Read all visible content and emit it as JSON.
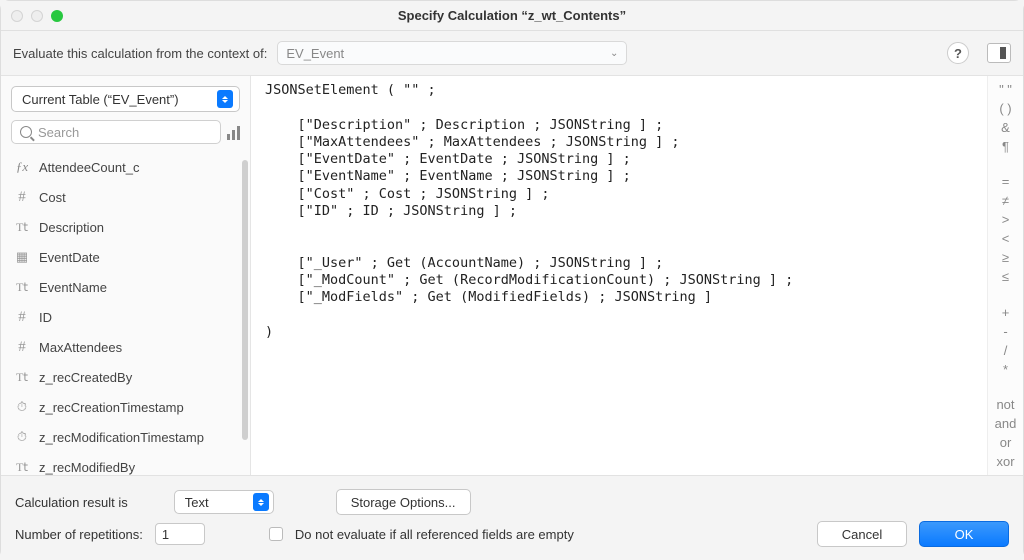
{
  "window": {
    "title": "Specify Calculation “z_wt_Contents”"
  },
  "context": {
    "label": "Evaluate this calculation from the context of:",
    "value": "EV_Event",
    "help": "?"
  },
  "sidebar": {
    "table_select": "Current Table (“EV_Event”)",
    "search_placeholder": "Search",
    "fields": [
      {
        "icon": "fx",
        "label": "AttendeeCount_c"
      },
      {
        "icon": "hash",
        "label": "Cost"
      },
      {
        "icon": "tt",
        "label": "Description"
      },
      {
        "icon": "cal",
        "label": "EventDate"
      },
      {
        "icon": "tt",
        "label": "EventName"
      },
      {
        "icon": "hash",
        "label": "ID"
      },
      {
        "icon": "hash",
        "label": "MaxAttendees"
      },
      {
        "icon": "tt",
        "label": "z_recCreatedBy"
      },
      {
        "icon": "clock",
        "label": "z_recCreationTimestamp"
      },
      {
        "icon": "clock",
        "label": "z_recModificationTimestamp"
      },
      {
        "icon": "tt",
        "label": "z_recModifiedBy"
      }
    ]
  },
  "editor": {
    "text": "JSONSetElement ( \"\" ;\n\n    [\"Description\" ; Description ; JSONString ] ;\n    [\"MaxAttendees\" ; MaxAttendees ; JSONString ] ;\n    [\"EventDate\" ; EventDate ; JSONString ] ;\n    [\"EventName\" ; EventName ; JSONString ] ;\n    [\"Cost\" ; Cost ; JSONString ] ;\n    [\"ID\" ; ID ; JSONString ] ;\n\n\n    [\"_User\" ; Get (AccountName) ; JSONString ] ;\n    [\"_ModCount\" ; Get (RecordModificationCount) ; JSONString ] ;\n    [\"_ModFields\" ; Get (ModifiedFields) ; JSONString ]\n\n)"
  },
  "operators": [
    "\" \"",
    "( )",
    "&",
    "¶",
    "",
    "=",
    "≠",
    ">",
    "<",
    "≥",
    "≤",
    "",
    "+",
    "-",
    "/",
    "*",
    "",
    "not",
    "and",
    "or",
    "xor"
  ],
  "footer": {
    "result_label": "Calculation result is",
    "result_type": "Text",
    "storage_btn": "Storage Options...",
    "reps_label": "Number of repetitions:",
    "reps_value": "1",
    "checkbox_label": "Do not evaluate if all referenced fields are empty",
    "cancel": "Cancel",
    "ok": "OK"
  },
  "icon_glyph": {
    "fx": "ƒx",
    "hash": "#",
    "tt": "T𝗍",
    "cal": "▦",
    "clock": "⏱"
  }
}
